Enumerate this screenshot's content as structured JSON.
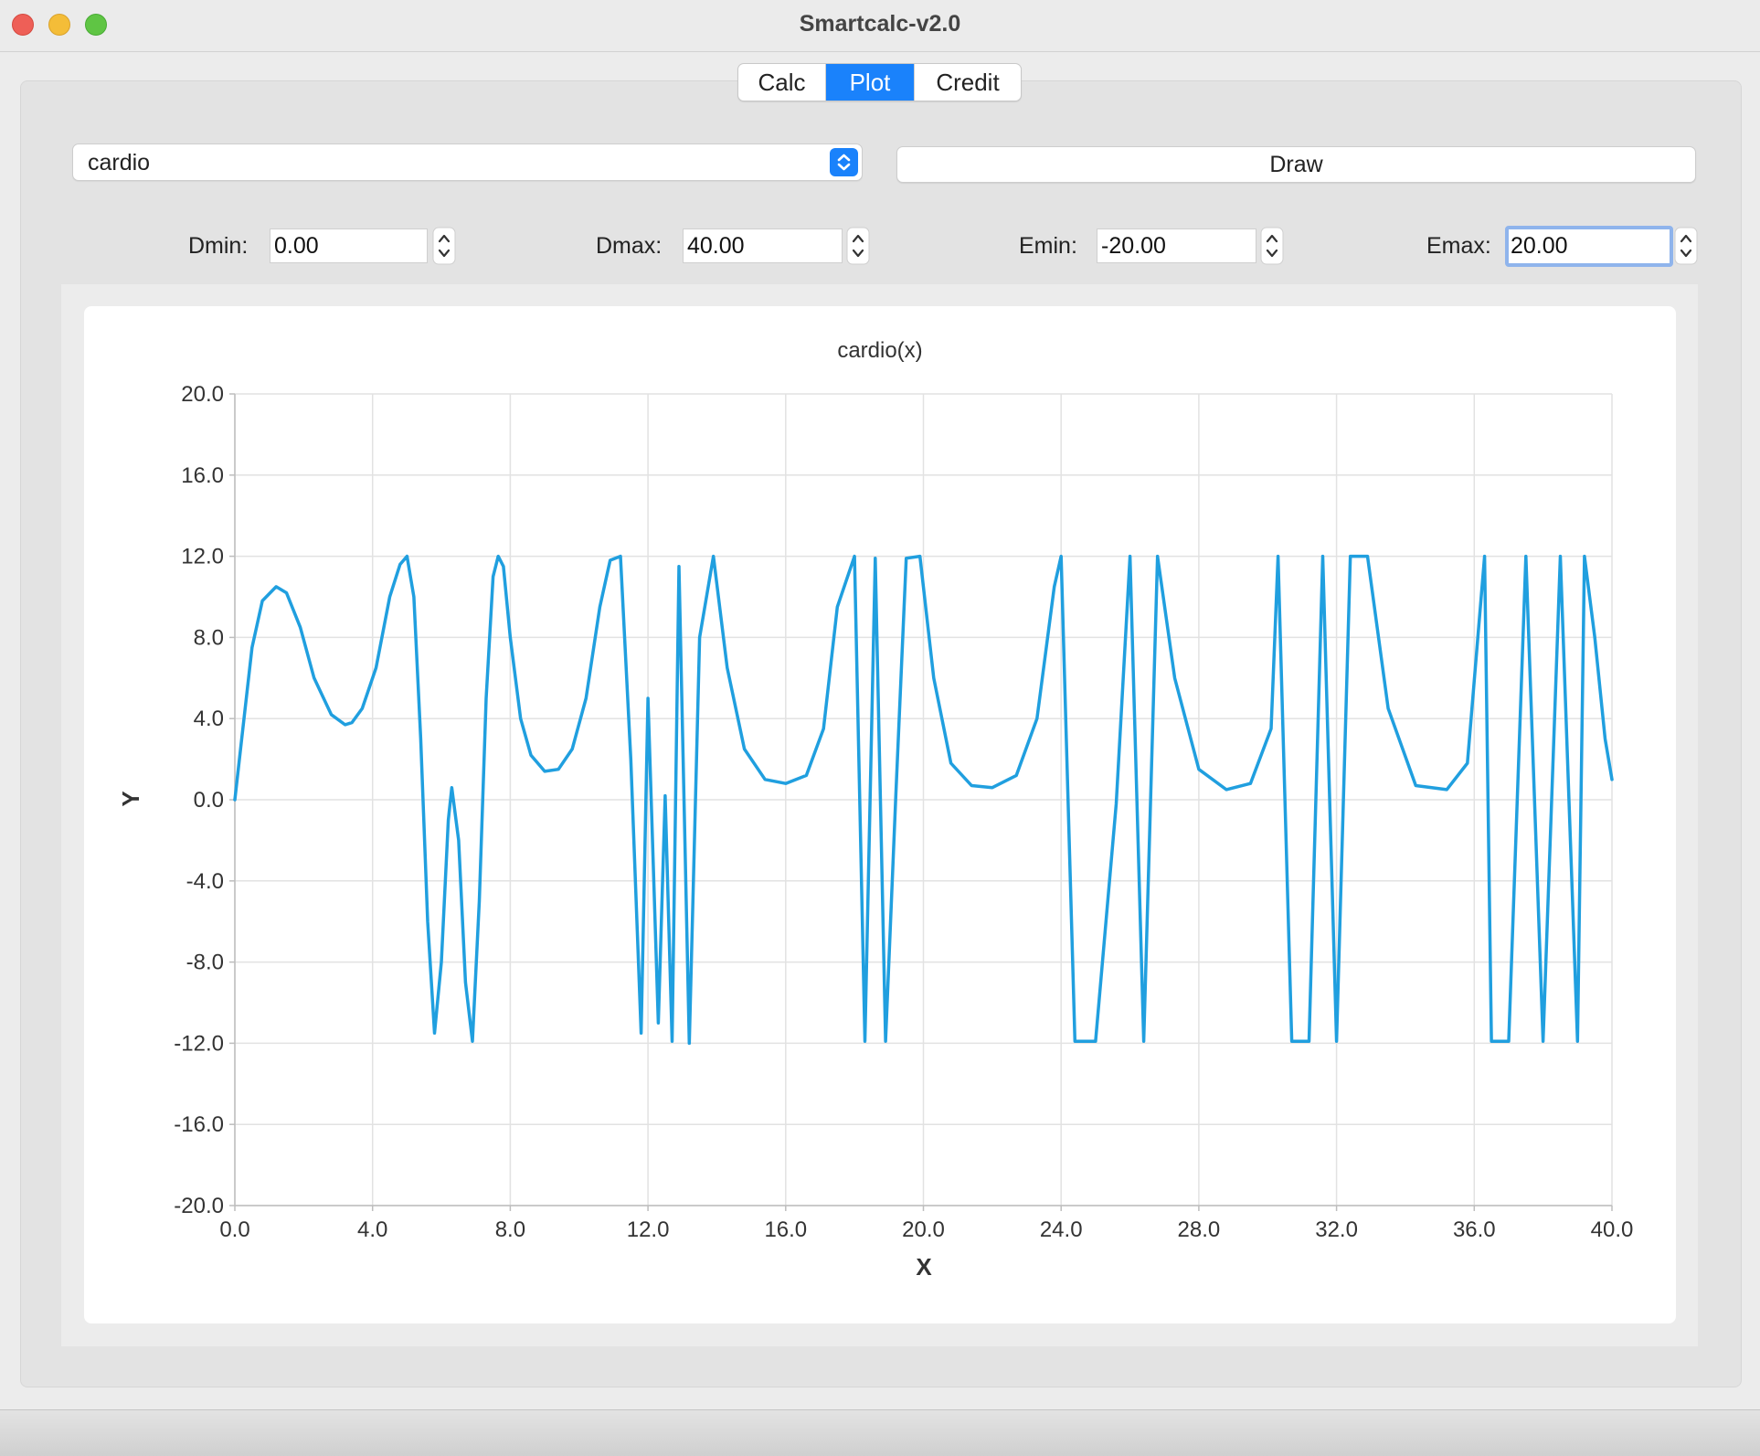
{
  "window": {
    "title": "Smartcalc-v2.0"
  },
  "tabs": [
    {
      "label": "Calc",
      "active": false
    },
    {
      "label": "Plot",
      "active": true
    },
    {
      "label": "Credit",
      "active": false
    }
  ],
  "function_select": {
    "value": "cardio"
  },
  "draw_button": {
    "label": "Draw"
  },
  "range": {
    "dmin": {
      "label": "Dmin:",
      "value": "0.00"
    },
    "dmax": {
      "label": "Dmax:",
      "value": "40.00"
    },
    "emin": {
      "label": "Emin:",
      "value": "-20.00"
    },
    "emax": {
      "label": "Emax:",
      "value": "20.00"
    }
  },
  "colors": {
    "accent": "#1a82fb",
    "series": "#209fdf"
  },
  "chart_data": {
    "type": "line",
    "title": "cardio(x)",
    "xlabel": "X",
    "ylabel": "Y",
    "xlim": [
      0,
      40
    ],
    "ylim": [
      -20,
      20
    ],
    "x_ticks": [
      "0.0",
      "4.0",
      "8.0",
      "12.0",
      "16.0",
      "20.0",
      "24.0",
      "28.0",
      "32.0",
      "36.0",
      "40.0"
    ],
    "y_ticks": [
      "20.0",
      "16.0",
      "12.0",
      "8.0",
      "4.0",
      "0.0",
      "-4.0",
      "-8.0",
      "-12.0",
      "-16.0",
      "-20.0"
    ],
    "grid": true,
    "legend": "none",
    "series": [
      {
        "x": [
          0,
          0.2,
          0.5,
          0.8,
          1.2,
          1.5,
          1.9,
          2.3,
          2.8,
          3.2,
          3.4,
          3.7,
          4.1,
          4.5,
          4.8,
          5.0,
          5.2,
          5.4,
          5.6,
          5.8,
          6.0,
          6.2,
          6.3,
          6.5,
          6.7,
          6.9,
          7.1,
          7.3,
          7.5,
          7.65,
          7.8,
          8.0,
          8.3,
          8.6,
          9.0,
          9.4,
          9.8,
          10.2,
          10.6,
          10.9,
          11.2,
          11.5,
          11.8,
          12.0,
          12.3,
          12.5,
          12.7,
          12.9,
          13.2,
          13.5,
          13.9,
          14.3,
          14.8,
          15.4,
          16.0,
          16.6,
          17.1,
          17.5,
          18.0,
          18.3,
          18.6,
          18.9,
          19.2,
          19.5,
          19.9,
          20.3,
          20.8,
          21.4,
          22.0,
          22.7,
          23.3,
          23.8,
          24.0,
          24.4,
          25.0,
          25.6,
          26.0,
          26.4,
          26.8,
          27.3,
          28.0,
          28.8,
          29.5,
          30.1,
          30.3,
          30.7,
          31.2,
          31.6,
          32.0,
          32.4,
          32.9,
          33.5,
          34.3,
          35.2,
          35.8,
          36.3,
          36.5,
          37.0,
          37.5,
          38.0,
          38.5,
          39.0,
          39.2,
          39.5,
          39.8,
          40.0
        ],
        "y": [
          0,
          3.0,
          7.5,
          9.8,
          10.5,
          10.2,
          8.5,
          6.0,
          4.2,
          3.7,
          3.8,
          4.5,
          6.5,
          10.0,
          11.6,
          12.0,
          10.0,
          3.0,
          -6.0,
          -11.5,
          -8.0,
          -1.0,
          0.6,
          -2.0,
          -9.0,
          -11.9,
          -5.0,
          5.0,
          11.0,
          12.0,
          11.5,
          8.0,
          4.0,
          2.2,
          1.4,
          1.5,
          2.5,
          5.0,
          9.5,
          11.8,
          12.0,
          2.0,
          -11.5,
          5.0,
          -11.0,
          0.2,
          -11.9,
          11.5,
          -12.0,
          8.0,
          12.0,
          6.5,
          2.5,
          1.0,
          0.8,
          1.2,
          3.5,
          9.5,
          12.0,
          -11.9,
          11.9,
          -11.9,
          0.3,
          11.9,
          12.0,
          6.0,
          1.8,
          0.7,
          0.6,
          1.2,
          4.0,
          10.5,
          12.0,
          -11.9,
          -11.9,
          -0.2,
          12.0,
          -11.9,
          12.0,
          6.0,
          1.5,
          0.5,
          0.8,
          3.5,
          12.0,
          -11.9,
          -11.9,
          12.0,
          -11.9,
          12.0,
          12.0,
          4.5,
          0.7,
          0.5,
          1.8,
          12.0,
          -11.9,
          -11.9,
          12.0,
          -11.9,
          12.0,
          -11.9,
          12.0,
          8.0,
          3.0,
          1.0
        ]
      }
    ]
  }
}
